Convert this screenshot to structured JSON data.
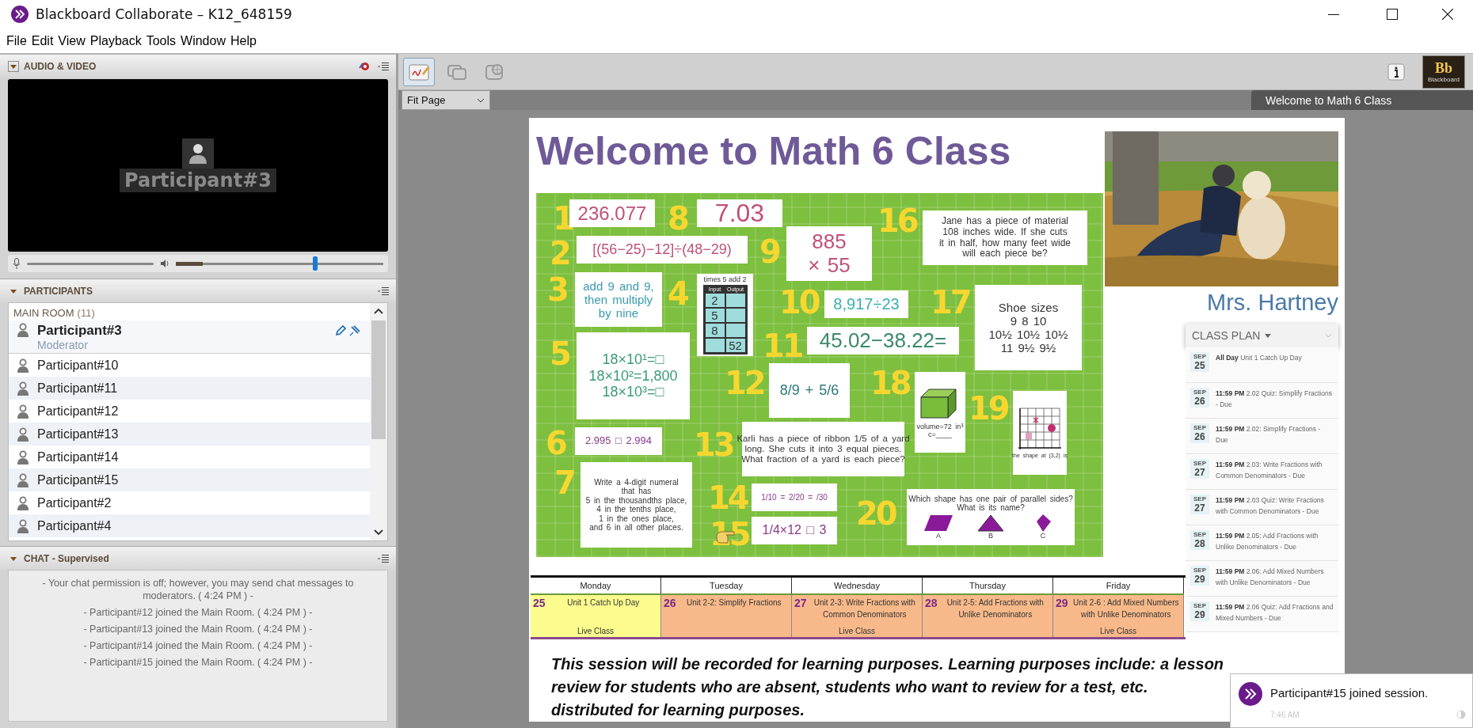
{
  "window": {
    "title": "Blackboard Collaborate – K12_648159"
  },
  "menu": [
    "File",
    "Edit",
    "View",
    "Playback",
    "Tools",
    "Window",
    "Help"
  ],
  "audio_video": {
    "title": "AUDIO & VIDEO",
    "speaker": "Participant#3",
    "meter": {
      "level": 0.13
    },
    "volume": {
      "level": 0.67
    }
  },
  "participants": {
    "title": "PARTICIPANTS",
    "room": "MAIN ROOM",
    "count": "(11)",
    "people": [
      {
        "name": "Participant#3",
        "role": "Moderator"
      },
      {
        "name": "Participant#10"
      },
      {
        "name": "Participant#11"
      },
      {
        "name": "Participant#12"
      },
      {
        "name": "Participant#13"
      },
      {
        "name": "Participant#14"
      },
      {
        "name": "Participant#15"
      },
      {
        "name": "Participant#2"
      },
      {
        "name": "Participant#4"
      }
    ]
  },
  "chat": {
    "title": "CHAT - Supervised",
    "messages": [
      "- Your chat permission is off; however, you may send chat messages to moderators. ( 4:24 PM ) -",
      "- Participant#12 joined the Main Room. ( 4:24 PM ) -",
      "- Participant#13 joined the Main Room. ( 4:24 PM ) -",
      "- Participant#14 joined the Main Room. ( 4:24 PM ) -",
      "- Participant#15 joined the Main Room. ( 4:24 PM ) -"
    ]
  },
  "toolbar": {
    "tools": [
      {
        "kind": "whiteboard",
        "selected": true
      },
      {
        "kind": "windows",
        "selected": false
      },
      {
        "kind": "web",
        "selected": false
      }
    ],
    "logo": "Bb",
    "logo_caption": "Blackboard"
  },
  "view": {
    "zoom": "Fit Page",
    "page_title": "Welcome to Math 6 Class"
  },
  "slide": {
    "title": "Welcome to Math 6 Class",
    "teacher": "Mrs. Hartney",
    "board": {
      "problems": [
        {
          "number": "1",
          "kind": "text",
          "lines": [
            "236.077"
          ]
        },
        {
          "number": "2",
          "kind": "text",
          "lines": [
            "[(56−25)−12]÷(48−29)"
          ]
        },
        {
          "number": "3",
          "kind": "text",
          "lines": [
            "add 9 and 9,",
            "then multiply",
            "by nine"
          ]
        },
        {
          "number": "4",
          "kind": "table",
          "caption": "times 5 add 2",
          "columns": [
            "Input",
            "Output"
          ],
          "rows": [
            [
              "2",
              ""
            ],
            [
              "5",
              ""
            ],
            [
              "8",
              ""
            ],
            [
              "",
              "52"
            ]
          ]
        },
        {
          "number": "5",
          "kind": "text",
          "lines": [
            "18×10¹=□",
            "18×10²=1,800",
            "18×10³=□"
          ]
        },
        {
          "number": "6",
          "kind": "text",
          "lines": [
            "2.995 □ 2.994"
          ]
        },
        {
          "number": "7",
          "kind": "text",
          "lines": [
            "Write a 4-digit numeral",
            "that has",
            "5 in the thousandths place,",
            "4 in the tenths place,",
            "1 in the ones place,",
            "and 6 in all other places."
          ]
        },
        {
          "number": "8",
          "kind": "text",
          "lines": [
            "7.03"
          ]
        },
        {
          "number": "9",
          "kind": "text",
          "lines": [
            "885",
            "× 55"
          ]
        },
        {
          "number": "10",
          "kind": "text",
          "lines": [
            "8,917÷23"
          ]
        },
        {
          "number": "11",
          "kind": "text",
          "lines": [
            "45.02−38.22="
          ]
        },
        {
          "number": "12",
          "kind": "text",
          "lines": [
            "8/9 + 5/6"
          ]
        },
        {
          "number": "13",
          "kind": "text",
          "lines": [
            "Karli has a piece of ribbon 1/5 of a yard",
            "long.  She cuts it into 3 equal pieces.",
            "What fraction of a yard is each piece?"
          ]
        },
        {
          "number": "14",
          "kind": "text",
          "lines": [
            "1/10 = 2/20 = /30"
          ]
        },
        {
          "number": "15",
          "kind": "text",
          "lines": [
            "1/4×12 □ 3"
          ]
        },
        {
          "number": "16",
          "kind": "text",
          "lines": [
            "Jane has a piece of material",
            "108 inches wide.  If she cuts",
            "it in half, how many feet wide",
            "will each piece be?"
          ]
        },
        {
          "number": "17",
          "kind": "text",
          "lines": [
            "Shoe sizes",
            "9 8 10",
            "10½ 10½ 10½",
            "11 9½ 9½"
          ]
        },
        {
          "number": "18",
          "kind": "cuboid",
          "lines": [
            "volume=72 in³",
            "c=____"
          ]
        },
        {
          "number": "19",
          "kind": "grid",
          "caption": "the shape at (3,2) is"
        },
        {
          "number": "20",
          "kind": "shapes",
          "lines": [
            "Which shape has one pair of parallel sides?",
            "What is its name?"
          ],
          "shapes": [
            {
              "kind": "parallelogram",
              "label": "A"
            },
            {
              "kind": "triangle",
              "label": "B"
            },
            {
              "kind": "diamond",
              "label": "C"
            }
          ]
        }
      ]
    },
    "class_plan": {
      "title": "CLASS PLAN",
      "items": [
        {
          "month": "SEP",
          "day": "25",
          "time": "All Day",
          "text": "Unit 1 Catch Up Day"
        },
        {
          "month": "SEP",
          "day": "26",
          "time": "11:59 PM",
          "text": "2.02 Quiz: Simplify Fractions - Due"
        },
        {
          "month": "SEP",
          "day": "26",
          "time": "11:59 PM",
          "text": "2.02: Simplify Fractions - Due"
        },
        {
          "month": "SEP",
          "day": "27",
          "time": "11:59 PM",
          "text": "2.03: Write Fractions with Common Denominators - Due"
        },
        {
          "month": "SEP",
          "day": "27",
          "time": "11:59 PM",
          "text": "2.03 Quiz: Write Fractions with Common Denominators - Due"
        },
        {
          "month": "SEP",
          "day": "28",
          "time": "11:59 PM",
          "text": "2.05: Add Fractions with Unlike Denominators - Due"
        },
        {
          "month": "SEP",
          "day": "29",
          "time": "11:59 PM",
          "text": "2.06: Add Mixed Numbers with Unlike Denominators - Due"
        },
        {
          "month": "SEP",
          "day": "29",
          "time": "11:59 PM",
          "text": "2.06 Quiz: Add Fractions and Mixed Numbers - Due"
        }
      ]
    },
    "calendar": {
      "columns": [
        "Monday",
        "Tuesday",
        "Wednesday",
        "Thursday",
        "Friday"
      ],
      "cells": [
        {
          "day": "25",
          "text": "Unit 1 Catch Up Day",
          "note": "Live Class",
          "color": "#fbfb8e"
        },
        {
          "day": "26",
          "text": "Unit 2-2: Simplify Fractions",
          "color": "#f8b98a"
        },
        {
          "day": "27",
          "text": "Unit 2-3: Write Fractions with Common Denominators",
          "note": "Live Class",
          "color": "#f8b98a"
        },
        {
          "day": "28",
          "text": "Unit 2-5: Add Fractions with Unlike Denominators",
          "color": "#f8b98a"
        },
        {
          "day": "29",
          "text": "Unit 2-6 : Add Mixed Numbers with Unlike Denominators",
          "note": "Live Class",
          "color": "#f8b98a"
        }
      ]
    },
    "notice": [
      "This session will be recorded for learning purposes.  Learning purposes include: a lesson",
      "review for students who are absent, students who want to review for a test, etc.",
      "distributed for learning purposes."
    ]
  },
  "toast": {
    "message": "Participant#15 joined session.",
    "time": "7:46 AM"
  }
}
